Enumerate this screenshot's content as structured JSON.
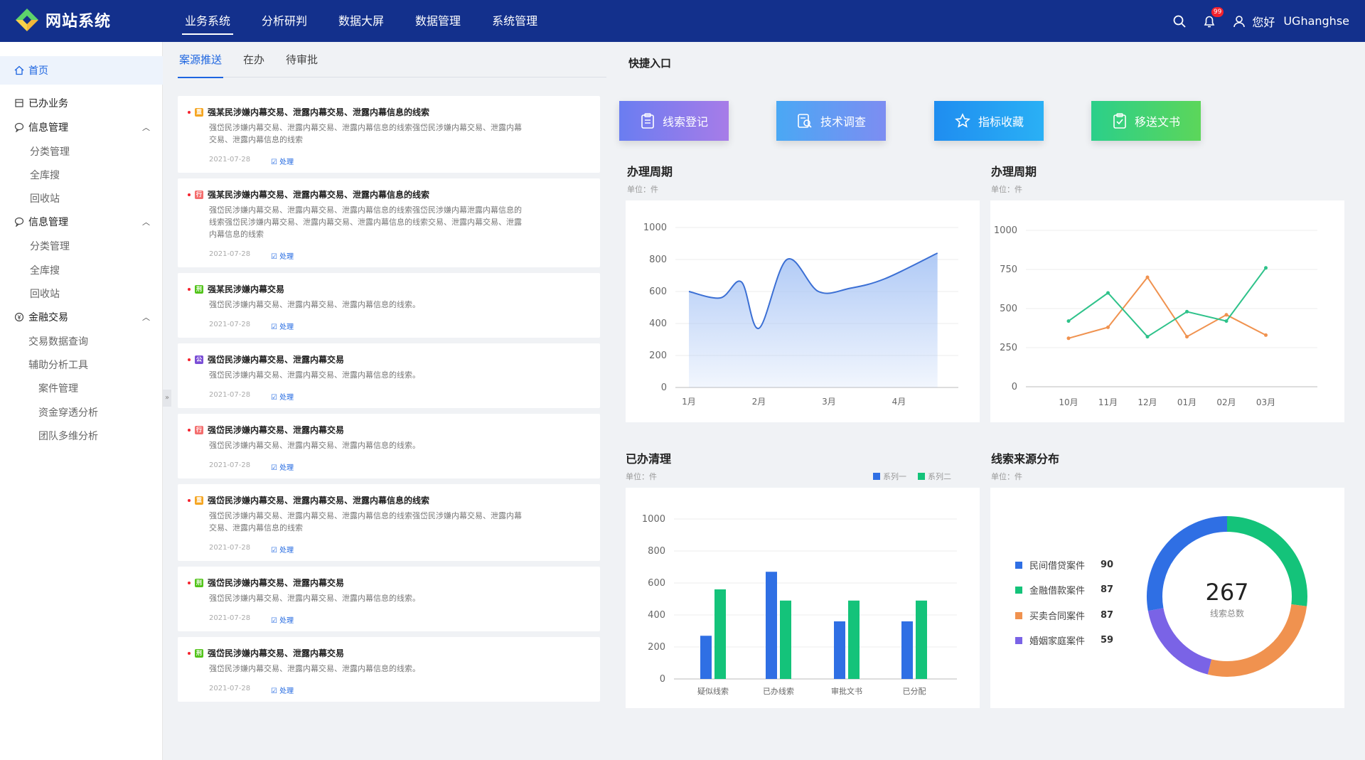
{
  "header": {
    "app_title": "网站系统",
    "nav": [
      "业务系统",
      "分析研判",
      "数据大屏",
      "数据管理",
      "系统管理"
    ],
    "notification_count": "99",
    "greeting": "您好",
    "username": "UGhanghse"
  },
  "sidebar": {
    "home": "首页",
    "done_business": "已办业务",
    "groups": [
      {
        "label": "信息管理",
        "items": [
          "分类管理",
          "全库搜",
          "回收站"
        ]
      },
      {
        "label": "信息管理",
        "items": [
          "分类管理",
          "全库搜",
          "回收站"
        ]
      },
      {
        "label": "金融交易",
        "items": [
          "交易数据查询",
          "辅助分析工具"
        ],
        "subitems": [
          "案件管理",
          "资金穿透分析",
          "团队多维分析"
        ]
      }
    ]
  },
  "tabs": [
    "案源推送",
    "在办",
    "待审批"
  ],
  "cases": [
    {
      "tag": "重",
      "tag_color": "#f5a623",
      "title": "强某民涉嫌内幕交易、泄露内幕交易、泄露内幕信息的线索",
      "lines": [
        "强岱民涉嫌内幕交易、泄露内幕交易、泄露内幕信息的线索强岱民涉嫌内幕交易、泄露内幕",
        "交易、泄露内幕信息的线索"
      ],
      "date": "2021-07-28",
      "action": "处理"
    },
    {
      "tag": "行",
      "tag_color": "#f46d6d",
      "title": "强某民涉嫌内幕交易、泄露内幕交易、泄露内幕信息的线索",
      "lines": [
        "强岱民涉嫌内幕交易、泄露内幕交易、泄露内幕信息的线索强岱民涉嫌内幕泄露内幕信息的",
        "线索强岱民涉嫌内幕交易、泄露内幕交易、泄露内幕信息的线索交易、泄露内幕交易、泄露",
        "内幕信息的线索"
      ],
      "date": "2021-07-28",
      "action": "处理"
    },
    {
      "tag": "刑",
      "tag_color": "#52c41a",
      "title": "强某民涉嫌内幕交易",
      "lines": [
        "强岱民涉嫌内幕交易、泄露内幕交易、泄露内幕信息的线索。"
      ],
      "date": "2021-07-28",
      "action": "处理"
    },
    {
      "tag": "公",
      "tag_color": "#7b4fd6",
      "title": "强岱民涉嫌内幕交易、泄露内幕交易",
      "lines": [
        "强岱民涉嫌内幕交易、泄露内幕交易、泄露内幕信息的线索。"
      ],
      "date": "2021-07-28",
      "action": "处理"
    },
    {
      "tag": "行",
      "tag_color": "#f46d6d",
      "title": "强岱民涉嫌内幕交易、泄露内幕交易",
      "lines": [
        "强岱民涉嫌内幕交易、泄露内幕交易、泄露内幕信息的线索。"
      ],
      "date": "2021-07-28",
      "action": "处理"
    },
    {
      "tag": "重",
      "tag_color": "#f5a623",
      "title": "强岱民涉嫌内幕交易、泄露内幕交易、泄露内幕信息的线索",
      "lines": [
        "强岱民涉嫌内幕交易、泄露内幕交易、泄露内幕信息的线索强岱民涉嫌内幕交易、泄露内幕",
        "交易、泄露内幕信息的线索"
      ],
      "date": "2021-07-28",
      "action": "处理"
    },
    {
      "tag": "刑",
      "tag_color": "#52c41a",
      "title": "强岱民涉嫌内幕交易、泄露内幕交易",
      "lines": [
        "强岱民涉嫌内幕交易、泄露内幕交易、泄露内幕信息的线索。"
      ],
      "date": "2021-07-28",
      "action": "处理"
    },
    {
      "tag": "刑",
      "tag_color": "#52c41a",
      "title": "强岱民涉嫌内幕交易、泄露内幕交易",
      "lines": [
        "强岱民涉嫌内幕交易、泄露内幕交易、泄露内幕信息的线索。"
      ],
      "date": "2021-07-28",
      "action": "处理"
    }
  ],
  "quick": {
    "title": "快捷入口",
    "buttons": [
      {
        "label": "线索登记",
        "icon": "clipboard-icon"
      },
      {
        "label": "技术调查",
        "icon": "investigate-icon"
      },
      {
        "label": "指标收藏",
        "icon": "star-icon"
      },
      {
        "label": "移送文书",
        "icon": "document-icon"
      }
    ]
  },
  "chart_data": [
    {
      "type": "area",
      "title": "办理周期",
      "unit": "单位：件",
      "categories": [
        "1月",
        "2月",
        "3月",
        "4月"
      ],
      "x": [
        0,
        0.45,
        0.75,
        1.0,
        1.4,
        1.85,
        2.3,
        2.8,
        3.55
      ],
      "values": [
        600,
        560,
        660,
        370,
        800,
        600,
        620,
        680,
        840
      ],
      "ylim": [
        0,
        1000
      ],
      "yticks": [
        0,
        200,
        400,
        600,
        800,
        1000
      ],
      "colors": {
        "line": "#3b6fd4",
        "fill": "#a7c4f5"
      }
    },
    {
      "type": "line",
      "title": "办理周期",
      "unit": "单位：件",
      "categories": [
        "10月",
        "11月",
        "12月",
        "01月",
        "02月",
        "03月"
      ],
      "series": [
        {
          "values": [
            310,
            380,
            700,
            320,
            460,
            330
          ],
          "color": "#f0924f"
        },
        {
          "values": [
            420,
            600,
            320,
            480,
            420,
            760
          ],
          "color": "#2ec28a"
        }
      ],
      "ylim": [
        0,
        1000
      ],
      "yticks": [
        0,
        250,
        500,
        750,
        1000
      ]
    },
    {
      "type": "bar",
      "title": "已办清理",
      "unit": "单位：件",
      "categories": [
        "疑似线索",
        "已办线索",
        "审批文书",
        "已分配"
      ],
      "series": [
        {
          "name": "系列一",
          "values": [
            270,
            670,
            360,
            360
          ],
          "color": "#2f6fe4"
        },
        {
          "name": "系列二",
          "values": [
            560,
            490,
            490,
            490
          ],
          "color": "#14c37a"
        }
      ],
      "ylim": [
        0,
        1000
      ],
      "yticks": [
        0,
        200,
        400,
        600,
        800,
        1000
      ]
    },
    {
      "type": "pie",
      "title": "线索来源分布",
      "unit": "单位：件",
      "total": "267",
      "total_label": "线索总数",
      "slices": [
        {
          "label": "民间借贷案件",
          "value": 90,
          "color": "#2f6fe4"
        },
        {
          "label": "金融借款案件",
          "value": 87,
          "color": "#14c37a"
        },
        {
          "label": "买卖合同案件",
          "value": 87,
          "color": "#f0924f"
        },
        {
          "label": "婚姻家庭案件",
          "value": 59,
          "color": "#7a63e6"
        }
      ]
    }
  ]
}
